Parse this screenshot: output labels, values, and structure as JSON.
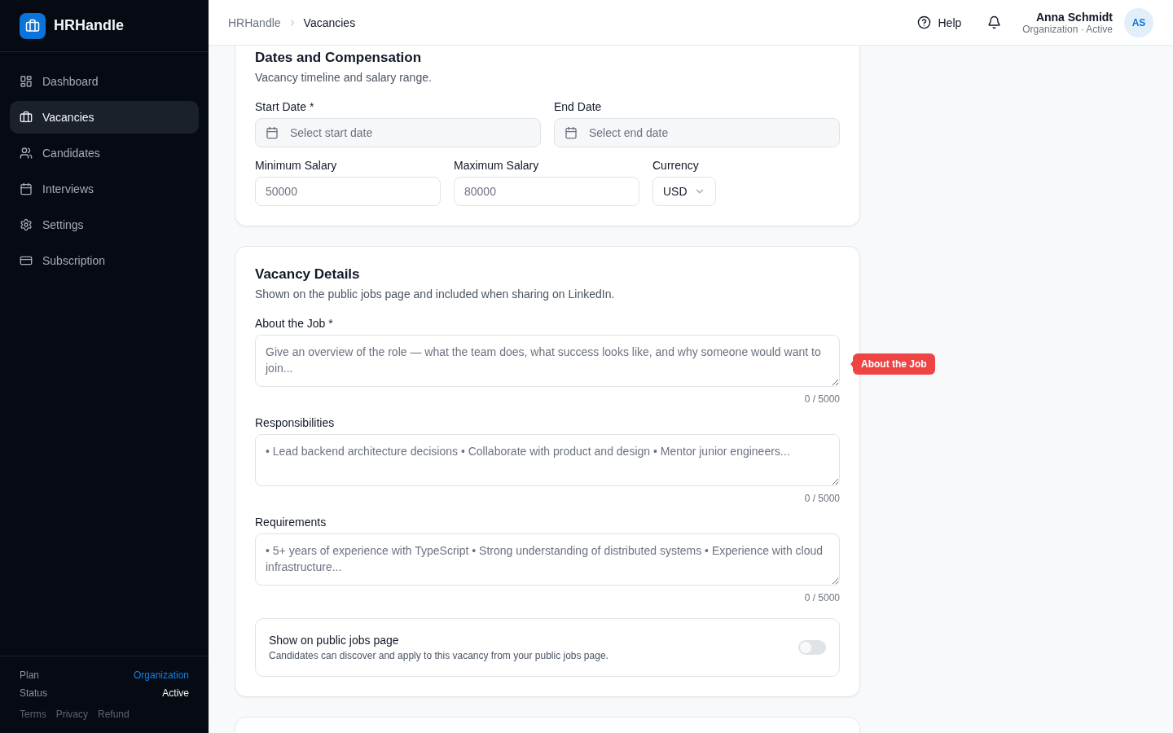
{
  "app": {
    "name": "HRHandle"
  },
  "sidebar": {
    "items": [
      {
        "label": "Dashboard",
        "selected": false
      },
      {
        "label": "Vacancies",
        "selected": true
      },
      {
        "label": "Candidates",
        "selected": false
      },
      {
        "label": "Interviews",
        "selected": false
      },
      {
        "label": "Settings",
        "selected": false
      },
      {
        "label": "Subscription",
        "selected": false
      }
    ],
    "footer": {
      "plan_label": "Plan",
      "plan_value": "Organization",
      "status_label": "Status",
      "status_value": "Active",
      "links": [
        "Terms",
        "Privacy",
        "Refund"
      ]
    }
  },
  "header": {
    "breadcrumbs": [
      "HRHandle",
      "Vacancies"
    ],
    "help": "Help",
    "user": {
      "name": "Anna Schmidt",
      "subtitle": "Organization · Active",
      "initials": "AS"
    }
  },
  "cards": [
    {
      "title": "Dates and Compensation",
      "description": "Vacancy timeline and salary range.",
      "rows": [
        [
          {
            "kind": "date",
            "label": "Start Date *",
            "placeholder": "Select start date"
          },
          {
            "kind": "date",
            "label": "End Date",
            "placeholder": "Select end date"
          }
        ],
        [
          {
            "kind": "text",
            "label": "Minimum Salary",
            "placeholder": "50000"
          },
          {
            "kind": "text",
            "label": "Maximum Salary",
            "placeholder": "80000"
          },
          {
            "kind": "select",
            "label": "Currency",
            "value": "USD"
          }
        ]
      ]
    },
    {
      "title": "Vacancy Details",
      "description": "Shown on the public jobs page and included when sharing on LinkedIn.",
      "rows": [
        [
          {
            "kind": "textarea",
            "label": "About the Job *",
            "placeholder": "Give an overview of the role — what the team does, what success looks like, and why someone would want to join...",
            "counter": "0 / 5000",
            "annotation": "About the Job"
          }
        ],
        [
          {
            "kind": "textarea",
            "label": "Responsibilities",
            "placeholder": "• Lead backend architecture decisions • Collaborate with product and design • Mentor junior engineers...",
            "counter": "0 / 5000"
          }
        ],
        [
          {
            "kind": "textarea",
            "label": "Requirements",
            "placeholder": "• 5+ years of experience with TypeScript • Strong understanding of distributed systems • Experience with cloud infrastructure...",
            "counter": "0 / 5000"
          }
        ],
        [
          {
            "kind": "toggle",
            "label": "Show on public jobs page",
            "description": "Candidates can discover and apply to this vacancy from your public jobs page.",
            "on": false
          }
        ]
      ]
    }
  ]
}
